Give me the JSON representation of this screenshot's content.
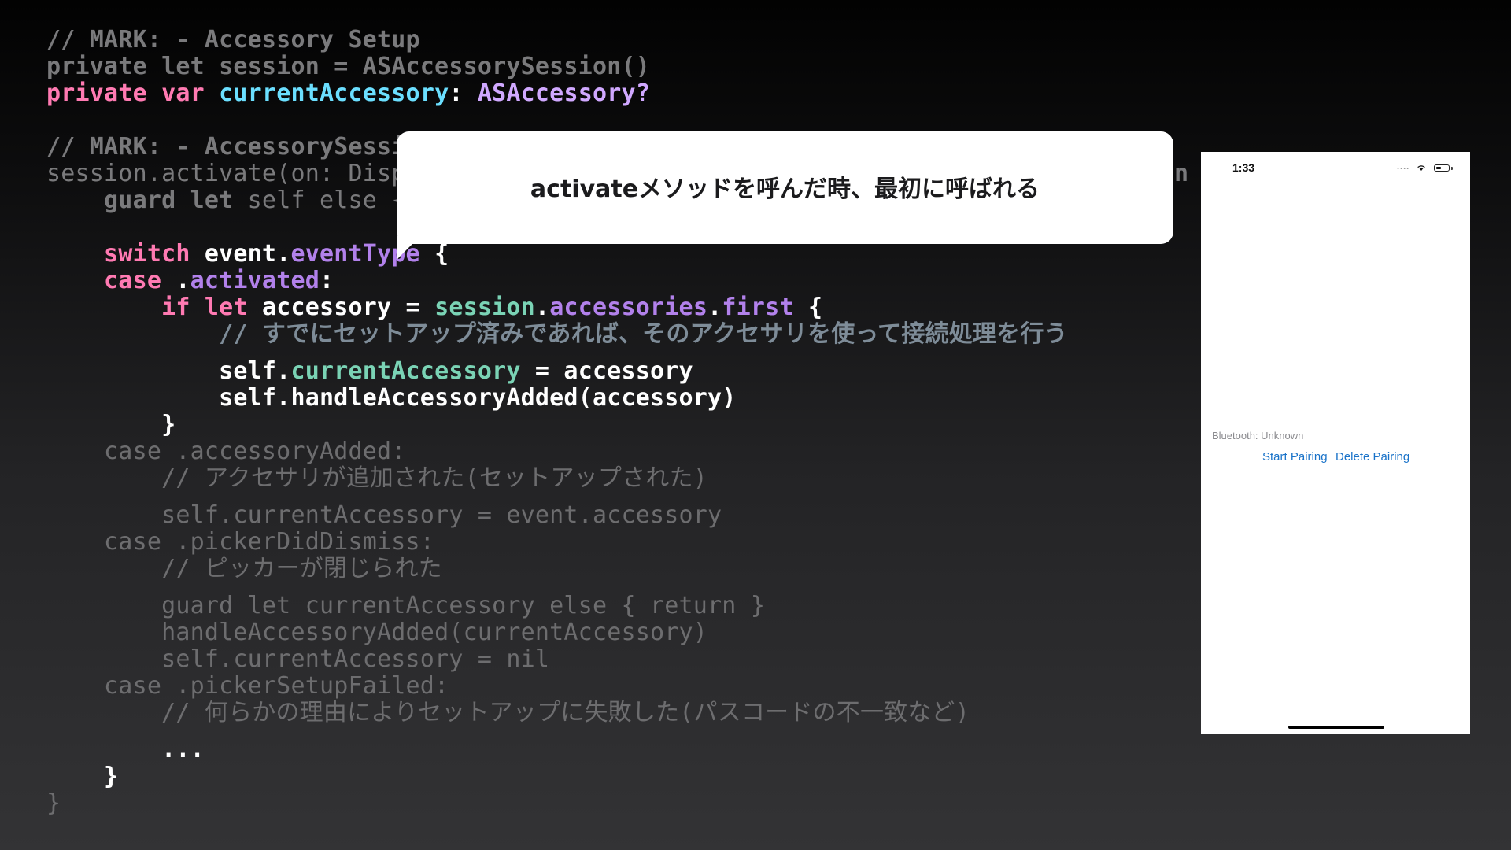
{
  "code": {
    "l1": "// MARK: - Accessory Setup",
    "l2": "private let session = ASAccessorySession()",
    "l3": {
      "kw": "private var",
      "name": "currentAccessory",
      "colon": ":",
      "type": "ASAccessory?"
    },
    "l4": "// MARK: - AccessorySessio",
    "l5": "session.activate(on: Dispa",
    "l5_tail": "n",
    "l6": {
      "guard": "guard let",
      "rest": "self else {"
    },
    "l7": {
      "kw": "switch",
      "obj": "event.",
      "prop": "eventType",
      "brace": "{"
    },
    "l8": {
      "kw": "case",
      "dot": ".",
      "value": "activated",
      "colon": ":"
    },
    "l9": {
      "kw": "if let",
      "var": "accessory =",
      "session": "session",
      "dot1": ".",
      "prop": "accessories",
      "dot2": ".",
      "first": "first",
      "brace": "{"
    },
    "l10": "// すでにセットアップ済みであれば、そのアクセサリを使って接続処理を行う",
    "l11": {
      "self": "self.",
      "prop": "currentAccessory",
      "rest": "= accessory"
    },
    "l12": "self.handleAccessoryAdded(accessory)",
    "l13": "}",
    "l14": "case .accessoryAdded:",
    "l15": "// アクセサリが追加された(セットアップされた)",
    "l16": "self.currentAccessory = event.accessory",
    "l17": "case .pickerDidDismiss:",
    "l18": "// ピッカーが閉じられた",
    "l19": "guard let currentAccessory else { return }",
    "l20": "handleAccessoryAdded(currentAccessory)",
    "l21": "self.currentAccessory = nil",
    "l22": "case .pickerSetupFailed:",
    "l23": "// 何らかの理由によりセットアップに失敗した(パスコードの不一致など)",
    "l24": "...",
    "l25": "}",
    "l26": "}"
  },
  "callout": {
    "text": "activateメソッドを呼んだ時、最初に呼ばれる"
  },
  "phone": {
    "time": "1:33",
    "signal": "....",
    "bluetooth_status": "Bluetooth: Unknown",
    "start_pairing": "Start Pairing",
    "delete_pairing": "Delete Pairing",
    "icons": [
      "wifi-icon",
      "battery-icon"
    ]
  }
}
